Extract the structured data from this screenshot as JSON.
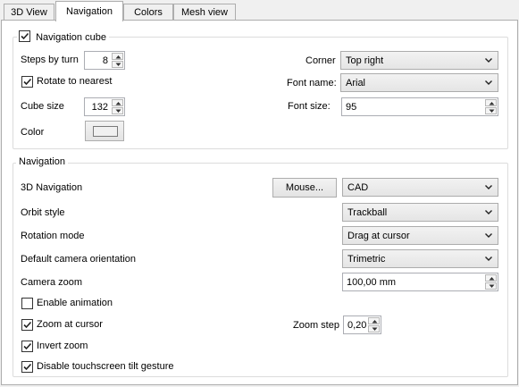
{
  "tabs": [
    {
      "label": "3D View"
    },
    {
      "label": "Navigation"
    },
    {
      "label": "Colors"
    },
    {
      "label": "Mesh view"
    }
  ],
  "nav_cube": {
    "group_label": "Navigation cube",
    "group_checked": true,
    "steps_by_turn_label": "Steps by turn",
    "steps_by_turn_value": "8",
    "rotate_to_nearest_label": "Rotate to nearest",
    "rotate_to_nearest_checked": true,
    "cube_size_label": "Cube size",
    "cube_size_value": "132",
    "color_label": "Color",
    "color_value": "#f0f0f0",
    "corner_label": "Corner",
    "corner_value": "Top right",
    "font_name_label": "Font name:",
    "font_name_value": "Arial",
    "font_size_label": "Font size:",
    "font_size_value": "95"
  },
  "navigation": {
    "group_label": "Navigation",
    "nav3d_label": "3D Navigation",
    "mouse_button_label": "Mouse...",
    "nav3d_value": "CAD",
    "orbit_style_label": "Orbit style",
    "orbit_style_value": "Trackball",
    "rotation_mode_label": "Rotation mode",
    "rotation_mode_value": "Drag at cursor",
    "camera_orientation_label": "Default camera orientation",
    "camera_orientation_value": "Trimetric",
    "camera_zoom_label": "Camera zoom",
    "camera_zoom_value": "100,00 mm",
    "enable_animation_label": "Enable animation",
    "enable_animation_checked": false,
    "zoom_at_cursor_label": "Zoom at cursor",
    "zoom_at_cursor_checked": true,
    "zoom_step_label": "Zoom step",
    "zoom_step_value": "0,20",
    "invert_zoom_label": "Invert zoom",
    "invert_zoom_checked": true,
    "disable_tilt_label": "Disable touchscreen tilt gesture",
    "disable_tilt_checked": true
  }
}
